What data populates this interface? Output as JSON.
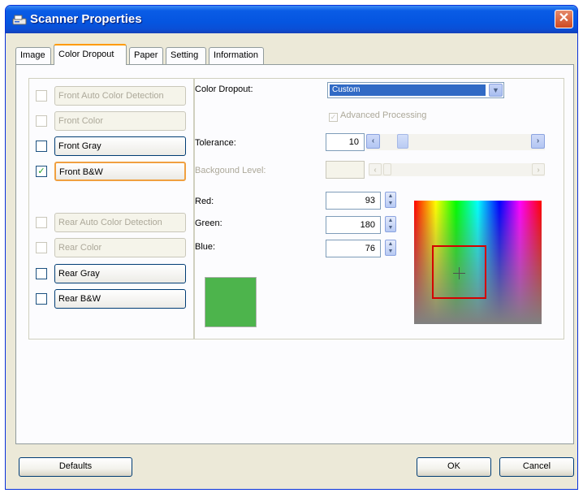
{
  "window": {
    "title": "Scanner Properties",
    "close_glyph": "✕"
  },
  "tabs": [
    {
      "label": "Image"
    },
    {
      "label": "Color Dropout"
    },
    {
      "label": "Paper"
    },
    {
      "label": "Setting"
    },
    {
      "label": "Information"
    }
  ],
  "active_tab": "Color Dropout",
  "dropout_options": [
    {
      "label": "Front Auto Color Detection",
      "checked": false,
      "enabled": false
    },
    {
      "label": "Front Color",
      "checked": false,
      "enabled": false
    },
    {
      "label": "Front Gray",
      "checked": false,
      "enabled": true
    },
    {
      "label": "Front B&W",
      "checked": true,
      "enabled": true,
      "focused": true
    },
    {
      "label": "Rear Auto Color Detection",
      "checked": false,
      "enabled": false
    },
    {
      "label": "Rear Color",
      "checked": false,
      "enabled": false
    },
    {
      "label": "Rear Gray",
      "checked": false,
      "enabled": true
    },
    {
      "label": "Rear B&W",
      "checked": false,
      "enabled": true
    }
  ],
  "color_dropout": {
    "label": "Color Dropout:",
    "value": "Custom"
  },
  "advanced_processing": {
    "label": "Advanced Processing",
    "checked": true,
    "enabled": false
  },
  "tolerance": {
    "label": "Tolerance:",
    "value": "10"
  },
  "background_level": {
    "label": "Backgound Level:",
    "value": ""
  },
  "rgb": {
    "red_label": "Red:",
    "red": "93",
    "green_label": "Green:",
    "green": "180",
    "blue_label": "Blue:",
    "blue": "76"
  },
  "swatch_color": "#4db44c",
  "buttons": {
    "defaults": "Defaults",
    "ok": "OK",
    "cancel": "Cancel"
  },
  "icons": {
    "checkmark": "✓",
    "left_arrow": "‹",
    "right_arrow": "›",
    "down_arrow": "▼",
    "spin_up": "▲",
    "spin_down": "▼"
  }
}
